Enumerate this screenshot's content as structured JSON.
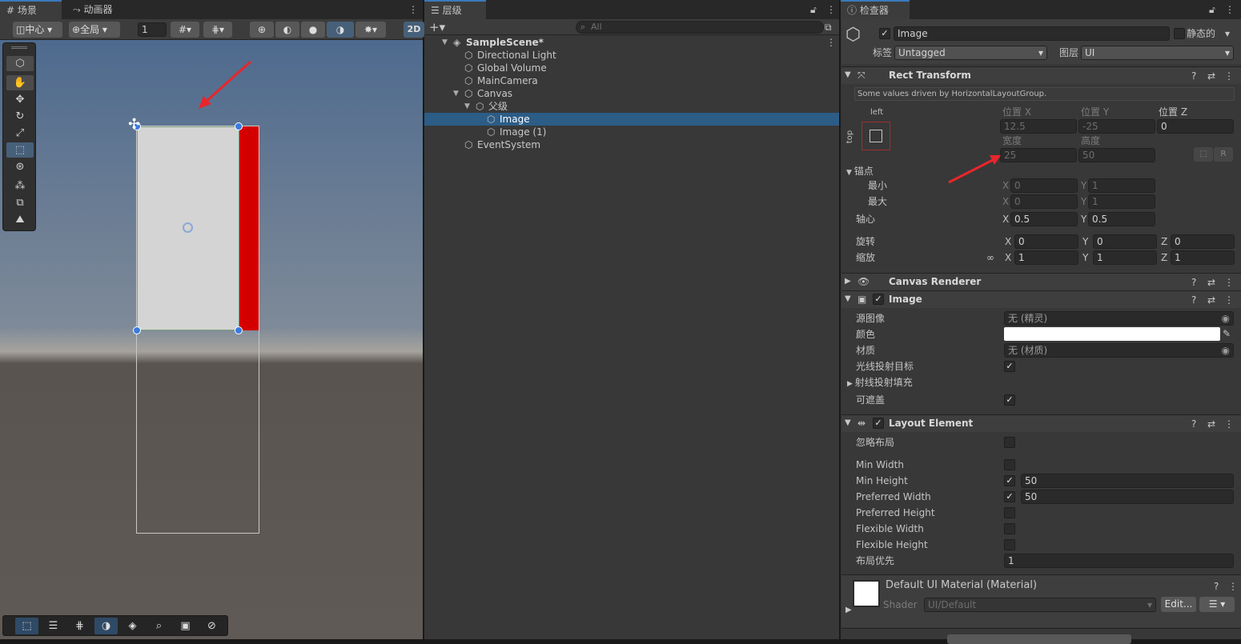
{
  "scene_panel": {
    "tabs": [
      {
        "icon": "grid-icon",
        "label": "场景"
      },
      {
        "icon": "animator-icon",
        "label": "动画器"
      }
    ],
    "toolbar": {
      "pivot_label": "中心",
      "space_label": "全局",
      "snap_value": "1",
      "mode_2d_label": "2D"
    },
    "tools": [
      "view-tool-icon",
      "move-tool-icon",
      "rotate-tool-icon",
      "scale-tool-icon",
      "rect-tool-icon",
      "transform-tool-icon",
      "custom-tool-icon",
      "custom-tool-2-icon",
      "custom-tool-3-icon"
    ]
  },
  "hierarchy": {
    "tab_label": "层级",
    "search_placeholder": "All",
    "items": [
      {
        "label": "SampleScene*",
        "depth": 0,
        "expanded": true,
        "selected": false
      },
      {
        "label": "Directional Light",
        "depth": 1,
        "selected": false
      },
      {
        "label": "Global Volume",
        "depth": 1,
        "selected": false
      },
      {
        "label": "MainCamera",
        "depth": 1,
        "selected": false
      },
      {
        "label": "Canvas",
        "depth": 1,
        "expanded": true,
        "selected": false
      },
      {
        "label": "父级",
        "depth": 2,
        "expanded": true,
        "selected": false
      },
      {
        "label": "Image",
        "depth": 3,
        "selected": true
      },
      {
        "label": "Image (1)",
        "depth": 3,
        "selected": false
      },
      {
        "label": "EventSystem",
        "depth": 1,
        "selected": false
      }
    ]
  },
  "inspector": {
    "tab_label": "检查器",
    "object_name": "Image",
    "static_label": "静态的",
    "tag_label": "标签",
    "tag_value": "Untagged",
    "layer_label": "图层",
    "layer_value": "UI",
    "rect_transform": {
      "title": "Rect Transform",
      "notice": "Some values driven by HorizontalLayoutGroup.",
      "anchor_h_label": "left",
      "anchor_v_label": "top",
      "pos_x_label": "位置 X",
      "pos_x": "12.5",
      "pos_y_label": "位置 Y",
      "pos_y": "-25",
      "pos_z_label": "位置 Z",
      "pos_z": "0",
      "width_label": "宽度",
      "width": "25",
      "height_label": "高度",
      "height": "50",
      "r_button": "R",
      "anchors_label": "锚点",
      "min_label": "最小",
      "min_x": "0",
      "min_y": "1",
      "max_label": "最大",
      "max_x": "0",
      "max_y": "1",
      "pivot_label": "轴心",
      "pivot_x": "0.5",
      "pivot_y": "0.5",
      "rotation_label": "旋转",
      "rot_x": "0",
      "rot_y": "0",
      "rot_z": "0",
      "scale_label": "缩放",
      "scale_x": "1",
      "scale_y": "1",
      "scale_z": "1",
      "axis_x": "X",
      "axis_y": "Y",
      "axis_z": "Z"
    },
    "canvas_renderer": {
      "title": "Canvas Renderer"
    },
    "image": {
      "title": "Image",
      "source_label": "源图像",
      "source_value": "无 (精灵)",
      "color_label": "颜色",
      "color_value": "#ffffff",
      "material_label": "材质",
      "material_value": "无 (材质)",
      "raycast_target_label": "光线投射目标",
      "raycast_target": true,
      "raycast_padding_label": "射线投射填充",
      "maskable_label": "可遮盖",
      "maskable": true
    },
    "layout_element": {
      "title": "Layout Element",
      "ignore_layout_label": "忽略布局",
      "ignore_layout": false,
      "min_width_label": "Min Width",
      "min_width_on": false,
      "min_height_label": "Min Height",
      "min_height_on": true,
      "min_height": "50",
      "preferred_width_label": "Preferred Width",
      "preferred_width_on": true,
      "preferred_width": "50",
      "preferred_height_label": "Preferred Height",
      "preferred_height_on": false,
      "flexible_width_label": "Flexible Width",
      "flexible_width_on": false,
      "flexible_height_label": "Flexible Height",
      "flexible_height_on": false,
      "priority_label": "布局优先",
      "priority": "1"
    },
    "material": {
      "title": "Default UI Material (Material)",
      "shader_label": "Shader",
      "shader_value": "UI/Default",
      "edit_button": "Edit..."
    }
  },
  "colors": {
    "selection": "#2c5d87",
    "accent": "#3a79bb",
    "annotation_arrow": "#e8262b",
    "sibling_image": "#d40000"
  }
}
